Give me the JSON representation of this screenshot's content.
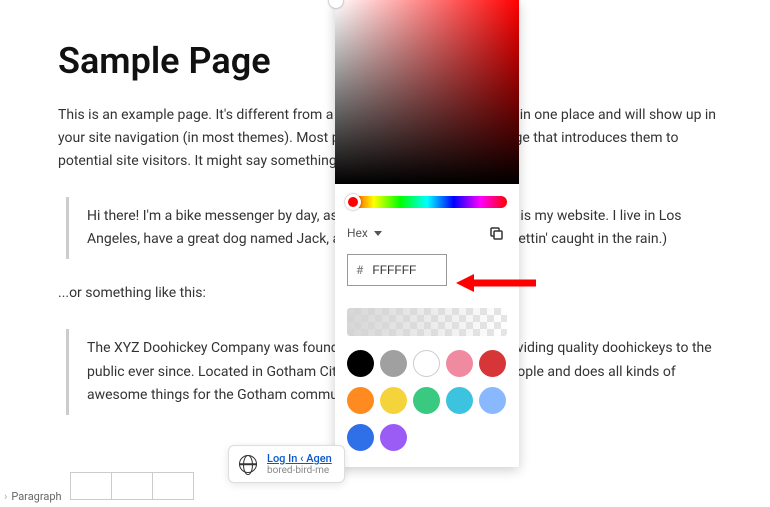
{
  "page": {
    "title": "Sample Page",
    "intro": "This is an example page. It's different from a blog post because it will stay in one place and will show up in your site navigation (in most themes). Most people start with an About page that introduces them to potential site visitors. It might say something like this:",
    "quote1": "Hi there! I'm a bike messenger by day, aspiring actor by night, and this is my website. I live in Los Angeles, have a great dog named Jack, and I like piña coladas. (And gettin' caught in the rain.)",
    "mid": "...or something like this:",
    "quote2": "The XYZ Doohickey Company was founded in 1971, and has been providing quality doohickeys to the public ever since. Located in Gotham City, XYZ employs over 2,000 people and does all kinds of awesome things for the Gotham community."
  },
  "picker": {
    "format_label": "Hex",
    "hex_prefix": "#",
    "hex_value": "FFFFFF",
    "swatches": [
      {
        "name": "black",
        "color": "#000000"
      },
      {
        "name": "gray",
        "color": "#a0a0a0"
      },
      {
        "name": "white",
        "color": "#ffffff"
      },
      {
        "name": "pink",
        "color": "#f08aa0"
      },
      {
        "name": "red",
        "color": "#d63638"
      },
      {
        "name": "orange",
        "color": "#ff8a1f"
      },
      {
        "name": "yellow",
        "color": "#f5d33a"
      },
      {
        "name": "green",
        "color": "#39c980"
      },
      {
        "name": "cyan",
        "color": "#3cc3e0"
      },
      {
        "name": "lightblue",
        "color": "#8ab8ff"
      },
      {
        "name": "blue",
        "color": "#2f6fe8"
      },
      {
        "name": "purple",
        "color": "#9b5cf5"
      }
    ]
  },
  "login_popup": {
    "link": "Log In ‹ Agen",
    "sub": "bored-bird-me"
  },
  "breadcrumb": {
    "block_type": "Paragraph"
  }
}
